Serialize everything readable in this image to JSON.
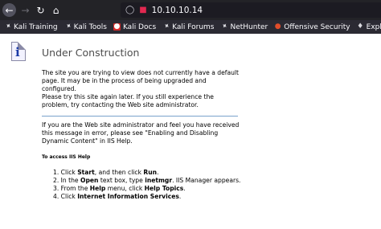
{
  "browser": {
    "url": "10.10.10.14",
    "bookmarks": [
      {
        "label": "Kali Training",
        "icon": "kali-dragon-icon"
      },
      {
        "label": "Kali Tools",
        "icon": "kali-dragon-icon"
      },
      {
        "label": "Kali Docs",
        "icon": "kali-docs-icon"
      },
      {
        "label": "Kali Forums",
        "icon": "kali-dragon-icon"
      },
      {
        "label": "NetHunter",
        "icon": "nethunter-icon"
      },
      {
        "label": "Offensive Security",
        "icon": "offsec-icon"
      },
      {
        "label": "Exploit-DB",
        "icon": "exploit-db-icon"
      }
    ]
  },
  "page": {
    "title": "Under Construction",
    "para1": "The site you are trying to view does not currently have a default page. It may be in the process of being upgraded and configured.",
    "para2": "Please try this site again later. If you still experience the problem, try contacting the Web site administrator.",
    "para3": "If you are the Web site administrator and feel you have received this message in error, please see \"Enabling and Disabling Dynamic Content\" in IIS Help.",
    "help_heading": "To access IIS Help",
    "steps": [
      {
        "num": "1.",
        "pre": "Click ",
        "b1": "Start",
        "mid": ", and then click ",
        "b2": "Run",
        "post": "."
      },
      {
        "num": "2.",
        "pre": "In the ",
        "b1": "Open",
        "mid": " text box, type ",
        "b2": "inetmgr",
        "post": ". IIS Manager appears."
      },
      {
        "num": "3.",
        "pre": "From the ",
        "b1": "Help",
        "mid": " menu, click ",
        "b2": "Help Topics",
        "post": "."
      },
      {
        "num": "4.",
        "pre": "Click ",
        "b1": "Internet Information Services",
        "mid": "",
        "b2": "",
        "post": "."
      }
    ]
  },
  "colors": {
    "toolbar": "#232327",
    "bookmarks_bar": "#2b2a33",
    "rule": "#7aa2cc",
    "title_text": "#4d4d4d"
  }
}
